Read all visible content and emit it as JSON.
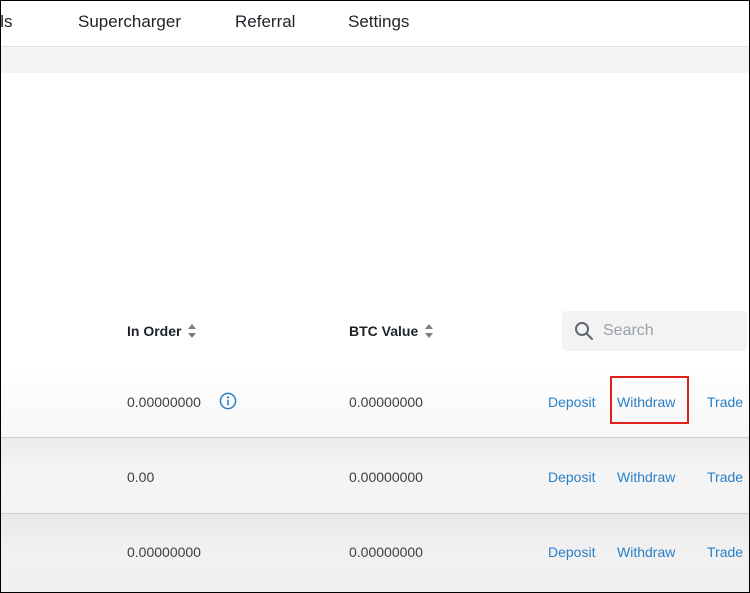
{
  "nav": {
    "items": [
      {
        "label": "ails"
      },
      {
        "label": "Supercharger"
      },
      {
        "label": "Referral"
      },
      {
        "label": "Settings"
      }
    ]
  },
  "table": {
    "headers": {
      "in_order": "In Order",
      "btc_value": "BTC Value"
    },
    "search": {
      "placeholder": "Search"
    },
    "rows": [
      {
        "in_order": "0.00000000",
        "btc_value": "0.00000000",
        "deposit": "Deposit",
        "withdraw": "Withdraw",
        "trade": "Trade"
      },
      {
        "in_order": "0.00",
        "btc_value": "0.00000000",
        "deposit": "Deposit",
        "withdraw": "Withdraw",
        "trade": "Trade"
      },
      {
        "in_order": "0.00000000",
        "btc_value": "0.00000000",
        "deposit": "Deposit",
        "withdraw": "Withdraw",
        "trade": "Trade"
      }
    ]
  },
  "icons": {
    "sort": "sort-arrows-icon",
    "search": "search-icon",
    "info": "info-icon"
  },
  "colors": {
    "link": "#2a7fc7",
    "highlight": "#e0201c",
    "text": "#1e2329"
  }
}
